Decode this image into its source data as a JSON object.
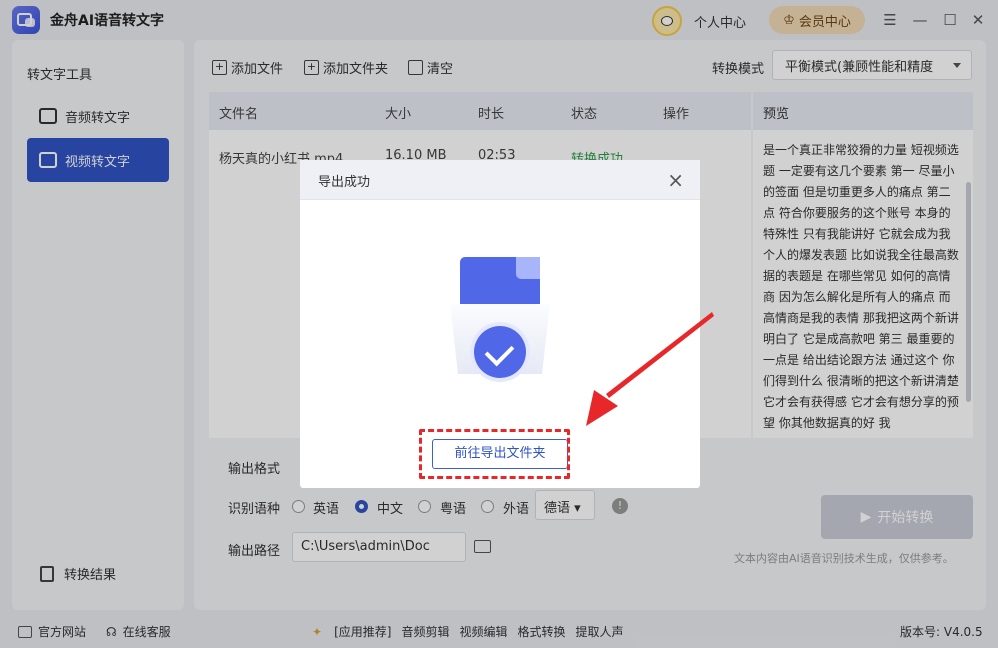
{
  "app": {
    "title": "金舟AI语音转文字"
  },
  "header": {
    "personal_center": "个人中心",
    "vip_center": "会员中心"
  },
  "sidebar": {
    "heading": "转文字工具",
    "items": [
      {
        "label": "音频转文字",
        "icon": "audio-to-text-icon"
      },
      {
        "label": "视频转文字",
        "icon": "video-to-text-icon",
        "active": true
      }
    ],
    "result": "转换结果"
  },
  "toolbar": {
    "add_file": "添加文件",
    "add_folder": "添加文件夹",
    "clear": "清空",
    "mode_label": "转换模式",
    "mode_value": "平衡模式(兼顾性能和精度"
  },
  "table": {
    "headers": [
      "文件名",
      "大小",
      "时长",
      "状态",
      "操作"
    ],
    "rows": [
      {
        "name": "杨天真的小红书.mp4",
        "size": "16.10 MB",
        "duration": "02:53",
        "status": "转换成功"
      }
    ]
  },
  "preview": {
    "header": "预览",
    "text": "是一个真正非常狡猾的力量 短视频选题 一定要有这几个要素 第一 尽量小的签面 但是切重更多人的痛点 第二点 符合你要服务的这个账号 本身的特殊性 只有我能讲好 它就会成为我个人的爆发表题 比如说我全往最高数据的表题是 在哪些常见 如何的高情商 因为怎么解化是所有人的痛点 而高情商是我的表情 那我把这两个新讲明白了 它是成高款吧 第三 最重要的一点是 给出结论跟方法 通过这个 你们得到什么 很清晰的把这个新讲清楚 它才会有获得感 它才会有想分享的预望 你其他数据真的好 我"
  },
  "options": {
    "format_label": "输出格式",
    "lang_label": "识别语种",
    "langs": [
      "英语",
      "中文",
      "粤语",
      "外语"
    ],
    "selected_lang": "中文",
    "foreign_lang": "德语",
    "path_label": "输出路径",
    "path_value": "C:\\Users\\admin\\Doc",
    "start_button": "开始转换",
    "note": "文本内容由AI语音识别技术生成，仅供参考。"
  },
  "dialog": {
    "title": "导出成功",
    "button": "前往导出文件夹"
  },
  "footer": {
    "website": "官方网站",
    "support": "在线客服",
    "links": [
      "[应用推荐]",
      "音频剪辑",
      "视频编辑",
      "格式转换",
      "提取人声"
    ],
    "version": "版本号: V4.0.5"
  },
  "colors": {
    "accent": "#2f54c4",
    "success": "#2e9c48",
    "highlight": "#e8272a"
  }
}
